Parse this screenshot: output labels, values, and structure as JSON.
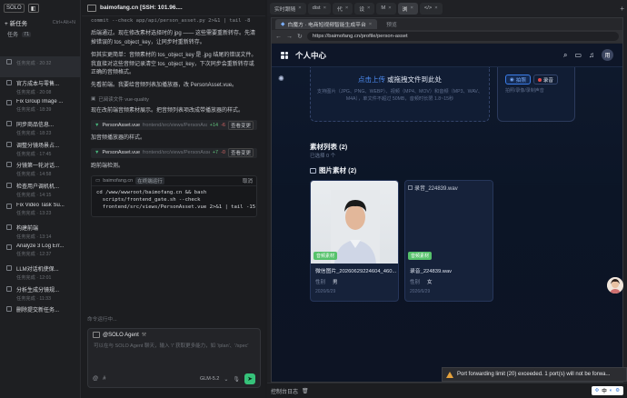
{
  "sidebar": {
    "logo": "SOLO",
    "new_task": "+ 新任务",
    "new_task_kbd": "Ctrl+Alt+N",
    "section_label": "任务",
    "section_count": "71",
    "tasks": [
      {
        "title": "",
        "sub": "任务完成 · 20:32"
      },
      {
        "title": "官方成本与零售...",
        "sub": "任务完成 · 20:08"
      },
      {
        "title": "Fix Group Image ...",
        "sub": "任务完成 · 18:39"
      },
      {
        "title": "同步商品信息...",
        "sub": "任务完成 · 18:23"
      },
      {
        "title": "调整分镜场景占...",
        "sub": "任务完成 · 17:45"
      },
      {
        "title": "分镜第一轮对话...",
        "sub": "任务完成 · 14:58"
      },
      {
        "title": "检查用户调机机...",
        "sub": "任务完成 · 14:15"
      },
      {
        "title": "Fix Video Task Su...",
        "sub": "任务完成 · 13:23"
      },
      {
        "title": "构建前端",
        "sub": "任务完成 · 13:14"
      },
      {
        "title": "Analyze 3 Log Err...",
        "sub": "任务完成 · 12:37"
      },
      {
        "title": "LLM对话机使保...",
        "sub": "任务完成 · 12:01"
      },
      {
        "title": "分析生成分镜规...",
        "sub": "任务完成 · 11:33"
      },
      {
        "title": "删除提交新任务...",
        "sub": ""
      }
    ]
  },
  "chat": {
    "workspace": "baimofang.cn [SSH: 101.96....",
    "top_cmd": "commit --check app/api/person_asset.py 2>&1 | tail -8",
    "p1": "后端通过。现在修改素材选择时的 jpg —— 这些需要重新转存。先清掉错误的 tos_object_key，让同步时重新转存。",
    "p2": "但其实更简单：音频素材的 tos_object_key 是 .jpg 结尾的错误文件。我直接对这些音频记录清空 tos_object_key，下次同步会重新转存或正确的音频格式。",
    "p3": "先看前端。我要给音频列表加播放器，改 PersonAsset.vue。",
    "thinking": "已阅读文件 vue-quality",
    "p4": "现在改前端音频素材展示。把音频列表项改成带播放器的样式。",
    "file1": {
      "name": "PersonAsset.vue",
      "path": "frontend/src/views/PersonAsset.vue",
      "add": "+14",
      "del": "-6",
      "view": "查看变更"
    },
    "p5": "加音频播放器的样式。",
    "file2": {
      "name": "PersonAsset.vue",
      "path": "frontend/src/views/PersonAsset.vue",
      "add": "+7",
      "del": "-0",
      "view": "查看变更"
    },
    "p6": "跑前端检测。",
    "term": {
      "host": "baimofang.cn",
      "badge": "在终端运行",
      "cancel": "取消",
      "code": "cd /www/wwwroot/baimofang.cn && bash\n  scripts/frontend_gate.sh --check\n  frontend/src/views/PersonAsset.vue 2>&1 | tail -15"
    },
    "running": "命令运行中...",
    "agent": {
      "title": "@SOLO Agent",
      "placeholder": "可以在与 SOLO Agent 聊天，输入 '/' 获取更多能力，如 '/plan'、'/spec'",
      "at": "@",
      "hash": "#",
      "model": "GLM-5.2"
    }
  },
  "pane": {
    "tabs": [
      {
        "label": "实时跟随"
      },
      {
        "label": "dist"
      },
      {
        "label": "代"
      },
      {
        "label": "设"
      },
      {
        "label": "M"
      },
      {
        "label": "浏"
      },
      {
        "label": "</>"
      }
    ],
    "browser": {
      "tab_active": "白魔方 · 电商短视频智能生成平台",
      "tab_other": "预览",
      "url": "https://baimofang.cn/profile/person-asset"
    },
    "app": {
      "title": "个人中心",
      "avatar": "用",
      "upload_main": "点击上传",
      "upload_main_rest": " 或拖拽文件到此处",
      "upload_hint": "支持图片（JPG、PNG、WEBP）、视频（MP4、MOV）和音频（MP3、WAV、M4A），单文件不超过 50MB，音频时长限 1.8~15秒",
      "cap_photo": "拍照",
      "cap_record": "录音",
      "cap_hint": "拍照/录像/录制声音",
      "list_title": "素材列表 (2)",
      "list_sub": "已选择 0 个",
      "group_title": "图片素材 (2)",
      "cards": [
        {
          "tag": "音频素材",
          "name": "微信图片_20260629224604_460...",
          "gender_label": "性别",
          "gender": "男",
          "date": "2026/6/29"
        },
        {
          "broken": "录音_224839.wav",
          "tag": "音频素材",
          "name": "录音_224839.wav",
          "gender_label": "性别",
          "gender": "女",
          "date": "2026/6/29"
        }
      ]
    },
    "statusbar": {
      "log": "控制台日志",
      "tray": "中"
    },
    "toast": "Port forwarding limit (20) exceeded. 1 port(s) will not be forwa..."
  }
}
